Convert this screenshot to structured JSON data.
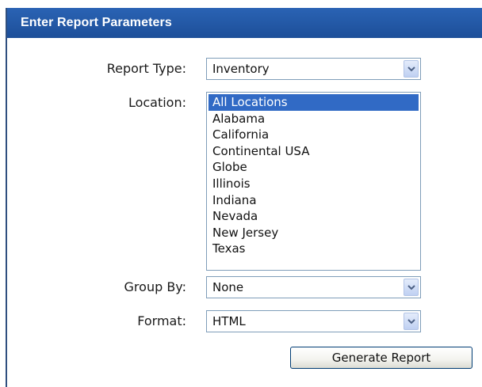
{
  "panel": {
    "title": "Enter Report Parameters"
  },
  "form": {
    "report_type": {
      "label": "Report Type:",
      "value": "Inventory"
    },
    "location": {
      "label": "Location:",
      "options": [
        "All Locations",
        "Alabama",
        "California",
        "Continental USA",
        "Globe",
        "Illinois",
        "Indiana",
        "Nevada",
        "New Jersey",
        "Texas"
      ],
      "selected_index": 0
    },
    "group_by": {
      "label": "Group By:",
      "value": "None"
    },
    "format": {
      "label": "Format:",
      "value": "HTML"
    },
    "generate_label": "Generate Report"
  },
  "colors": {
    "header_bg": "#1d4f99",
    "selection": "#316ac5"
  }
}
